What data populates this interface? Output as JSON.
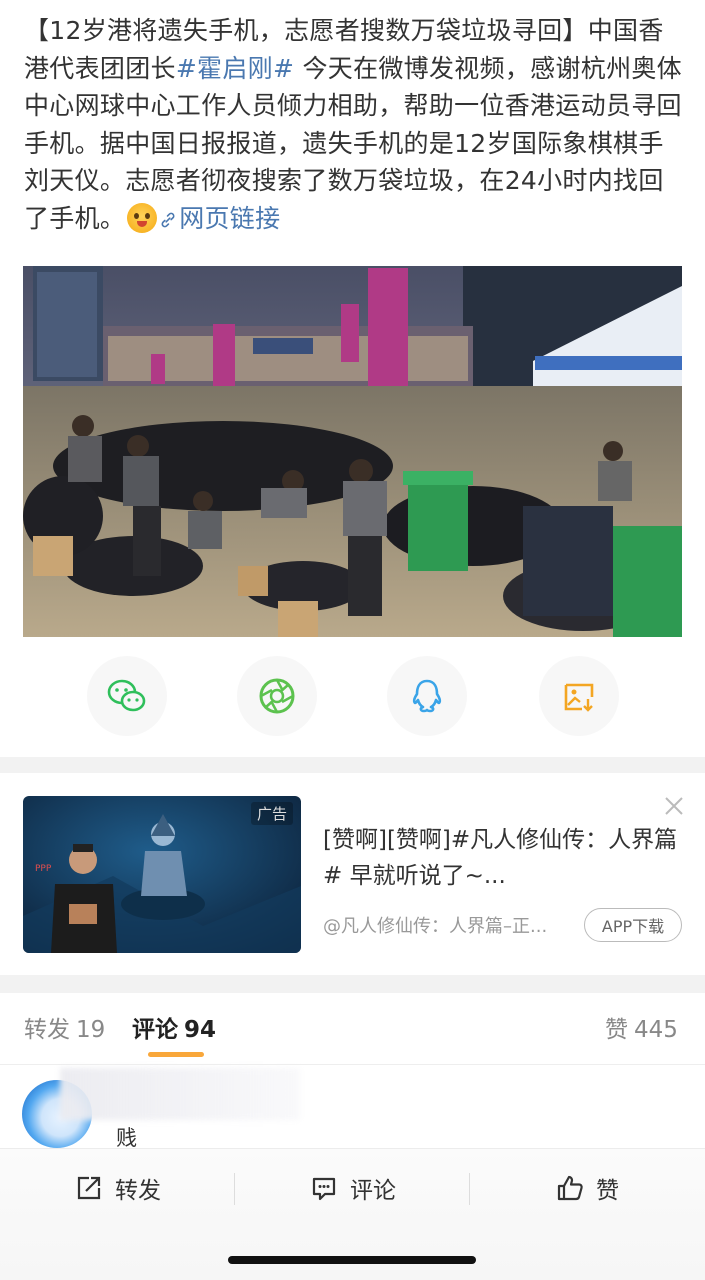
{
  "post": {
    "text_part1": "【12岁港将遗失手机，志愿者搜数万袋垃圾寻回】中国香港代表团团长",
    "hashtag": "#霍启刚#",
    "text_part2": " 今天在微博发视频，感谢杭州奥体中心网球中心工作人员倾力相助，帮助一位香港运动员寻回手机。据中国日报报道，遗失手机的是12岁国际象棋棋手刘天仪。志愿者彻夜搜索了数万袋垃圾，在24小时内找回了手机。",
    "link_text": "网页链接"
  },
  "share": {
    "icons": [
      "wechat-icon",
      "moments-icon",
      "qq-icon",
      "save-image-icon"
    ]
  },
  "ad": {
    "badge": "广告",
    "title": "[赞啊][赞啊]#凡人修仙传：人界篇# 早就听说了~...",
    "source": "@凡人修仙传：人界篇–正...",
    "download": "APP下载"
  },
  "tabs": {
    "repost_label": "转发",
    "repost_count": "19",
    "comment_label": "评论",
    "comment_count": "94",
    "like_label": "赞",
    "like_count": "445"
  },
  "comment": {
    "text": "贱"
  },
  "actions": {
    "repost": "转发",
    "comment": "评论",
    "like": "赞"
  },
  "colors": {
    "link": "#4a78b0",
    "tab_underline": "#f9a73a",
    "wechat": "#2fbf5b",
    "moments": "#5cc24e",
    "qq": "#3aa4e8",
    "save": "#f3a623"
  }
}
